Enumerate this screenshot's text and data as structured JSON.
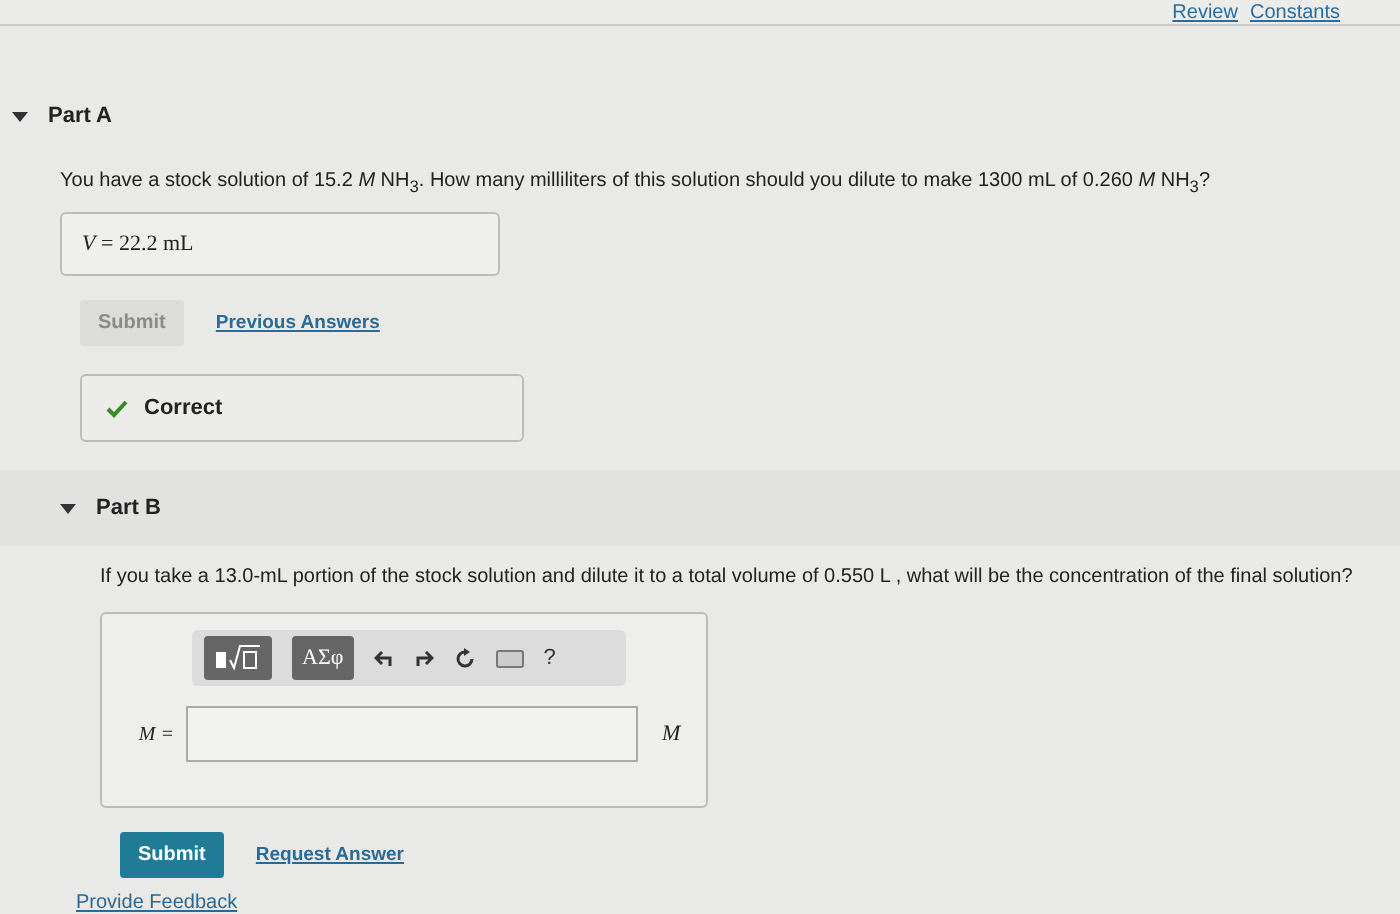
{
  "top_links": [
    "Review",
    "Constants"
  ],
  "part_a": {
    "title": "Part A",
    "expanded": true,
    "question": "You have a stock solution of 15.2 *M* NH$_{3}$. How many milliliters of this solution should you dilute to make 1300 mL of 0.260 *M* NH$_{3}$?",
    "answer": "*V* = 22.2 mL",
    "submit": {
      "label": "Submit",
      "disabled": true
    },
    "link": "Previous Answers",
    "feedback": "Correct"
  },
  "part_b": {
    "title": "Part B",
    "expanded": true,
    "question": "If you take a 13.0-mL portion of the stock solution and dilute it to a total volume of 0.550 L , what will be the concentration of the final solution?",
    "toolbar": {
      "symbols": "ΑΣφ",
      "help": "?"
    },
    "field_label": "M =",
    "unit": "M",
    "submit": {
      "label": "Submit",
      "disabled": false
    },
    "link": "Request Answer"
  },
  "footer_link": "Provide Feedback"
}
